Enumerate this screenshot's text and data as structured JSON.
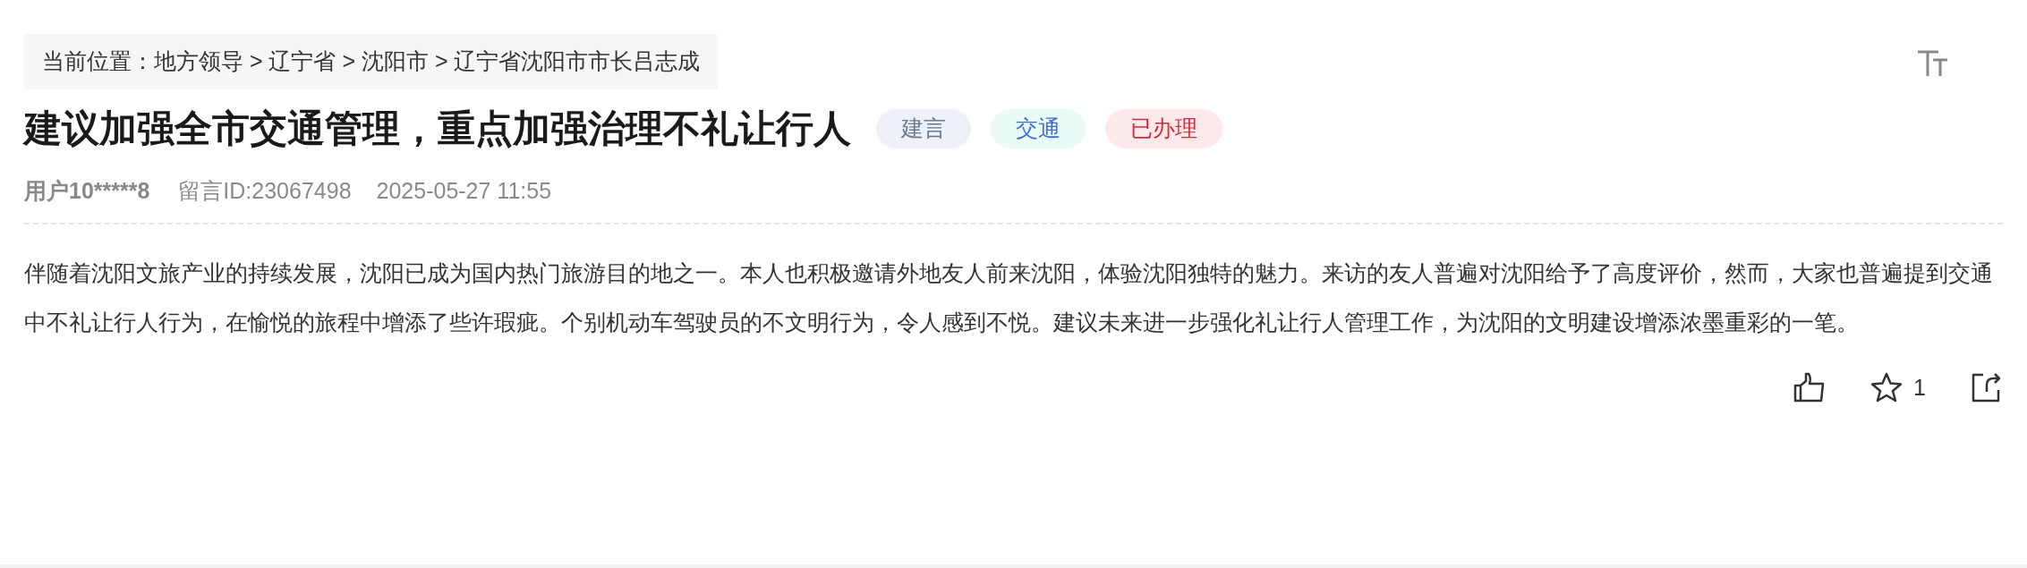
{
  "breadcrumb": "当前位置：地方领导 > 辽宁省 > 沈阳市 > 辽宁省沈阳市市长吕志成",
  "title": "建议加强全市交通管理，重点加强治理不礼让行人",
  "tags": [
    {
      "label": "建言",
      "kind": "type"
    },
    {
      "label": "交通",
      "kind": "field"
    },
    {
      "label": "已办理",
      "kind": "status"
    }
  ],
  "meta": {
    "user": "用户10*****8",
    "message_id": "留言ID:23067498",
    "time": "2025-05-27 11:55"
  },
  "body": "伴随着沈阳文旅产业的持续发展，沈阳已成为国内热门旅游目的地之一。本人也积极邀请外地友人前来沈阳，体验沈阳独特的魅力。来访的友人普遍对沈阳给予了高度评价，然而，大家也普遍提到交通中不礼让行人行为，在愉悦的旅程中增添了些许瑕疵。个别机动车驾驶员的不文明行为，令人感到不悦。建议未来进一步强化礼让行人管理工作，为沈阳的文明建设增添浓墨重彩的一笔。",
  "actions": {
    "favorite_count": "1"
  }
}
